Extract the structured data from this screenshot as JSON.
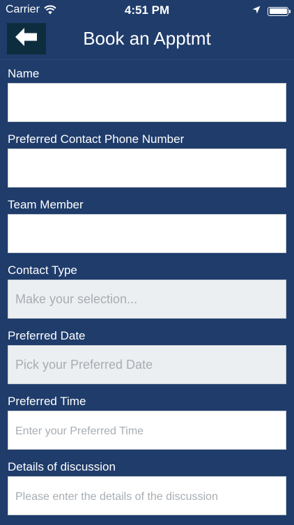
{
  "status_bar": {
    "carrier": "Carrier",
    "time": "4:51 PM",
    "battery_level": 1.0
  },
  "nav": {
    "title": "Book an Apptmt",
    "back_icon": "arrow-left-icon"
  },
  "form": {
    "fields": [
      {
        "label": "Name",
        "value": "",
        "placeholder": ""
      },
      {
        "label": "Preferred Contact Phone Number",
        "value": "",
        "placeholder": ""
      },
      {
        "label": "Team Member",
        "value": "",
        "placeholder": ""
      },
      {
        "label": "Contact Type",
        "value": "",
        "placeholder": "Make your selection..."
      },
      {
        "label": "Preferred Date",
        "value": "",
        "placeholder": "Pick your Preferred Date"
      },
      {
        "label": "Preferred Time",
        "value": "",
        "placeholder": "Enter your Preferred Time"
      },
      {
        "label": "Details of discussion",
        "value": "",
        "placeholder": "Please enter the details of the discussion"
      }
    ]
  },
  "colors": {
    "background": "#1f3c6b",
    "back_button": "#0d2d3f",
    "input_bg": "#ffffff",
    "picker_bg": "#eceff1",
    "placeholder": "#a7adb3"
  }
}
